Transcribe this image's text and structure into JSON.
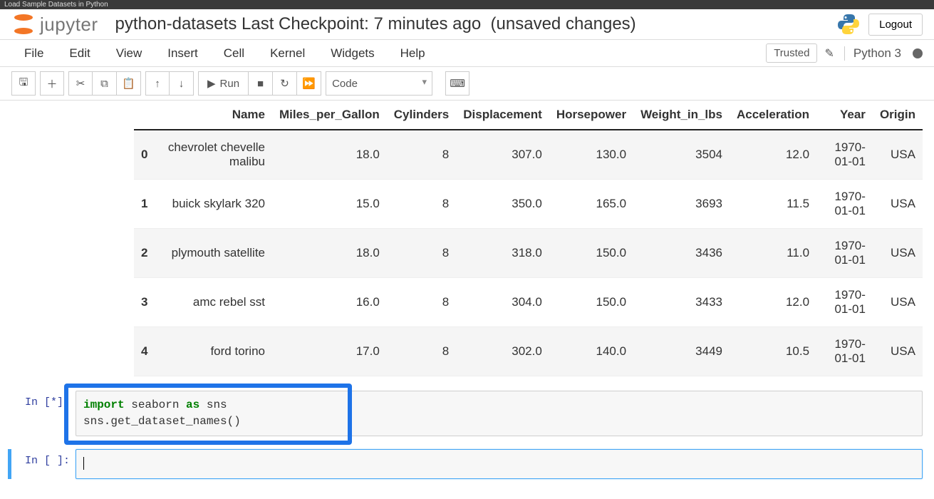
{
  "browser_tab": "Load Sample Datasets in Python",
  "logo_text": "jupyter",
  "title": "python-datasets",
  "checkpoint": "Last Checkpoint: 7 minutes ago",
  "unsaved": "(unsaved changes)",
  "logout": "Logout",
  "menu": {
    "file": "File",
    "edit": "Edit",
    "view": "View",
    "insert": "Insert",
    "cell": "Cell",
    "kernel": "Kernel",
    "widgets": "Widgets",
    "help": "Help"
  },
  "trusted": "Trusted",
  "kernel_name": "Python 3",
  "toolbar": {
    "run": "Run",
    "cell_type": "Code"
  },
  "table": {
    "headers": [
      "",
      "Name",
      "Miles_per_Gallon",
      "Cylinders",
      "Displacement",
      "Horsepower",
      "Weight_in_lbs",
      "Acceleration",
      "Year",
      "Origin"
    ],
    "rows": [
      [
        "0",
        "chevrolet chevelle malibu",
        "18.0",
        "8",
        "307.0",
        "130.0",
        "3504",
        "12.0",
        "1970-01-01",
        "USA"
      ],
      [
        "1",
        "buick skylark 320",
        "15.0",
        "8",
        "350.0",
        "165.0",
        "3693",
        "11.5",
        "1970-01-01",
        "USA"
      ],
      [
        "2",
        "plymouth satellite",
        "18.0",
        "8",
        "318.0",
        "150.0",
        "3436",
        "11.0",
        "1970-01-01",
        "USA"
      ],
      [
        "3",
        "amc rebel sst",
        "16.0",
        "8",
        "304.0",
        "150.0",
        "3433",
        "12.0",
        "1970-01-01",
        "USA"
      ],
      [
        "4",
        "ford torino",
        "17.0",
        "8",
        "302.0",
        "140.0",
        "3449",
        "10.5",
        "1970-01-01",
        "USA"
      ]
    ]
  },
  "cells": {
    "running_prompt": "In [*]:",
    "running_code_line1_kw1": "import",
    "running_code_line1_mid": " seaborn ",
    "running_code_line1_kw2": "as",
    "running_code_line1_end": " sns",
    "running_code_line2": "sns.get_dataset_names()",
    "empty_prompt": "In [ ]:"
  }
}
